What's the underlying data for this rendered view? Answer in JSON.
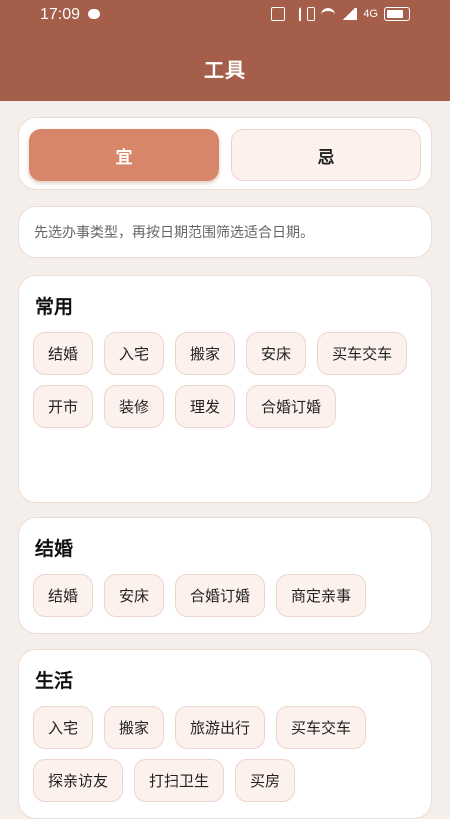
{
  "status_bar": {
    "time": "17:09",
    "network": "4G"
  },
  "header": {
    "title": "工具"
  },
  "segment": {
    "yi_label": "宜",
    "ji_label": "忌"
  },
  "hint": "先选办事类型，再按日期范围筛选适合日期。",
  "groups": [
    {
      "title": "常用",
      "chips": [
        "结婚",
        "入宅",
        "搬家",
        "安床",
        "买车交车",
        "开市",
        "装修",
        "理发",
        "合婚订婚"
      ]
    },
    {
      "title": "结婚",
      "chips": [
        "结婚",
        "安床",
        "合婚订婚",
        "商定亲事"
      ]
    },
    {
      "title": "生活",
      "chips": [
        "入宅",
        "搬家",
        "旅游出行",
        "买车交车",
        "探亲访友",
        "打扫卫生",
        "买房"
      ]
    }
  ],
  "colors": {
    "header_bg": "#a55e4a",
    "accent": "#d8866a",
    "chip_bg": "#fdf1ee",
    "page_bg": "#f5efec"
  }
}
